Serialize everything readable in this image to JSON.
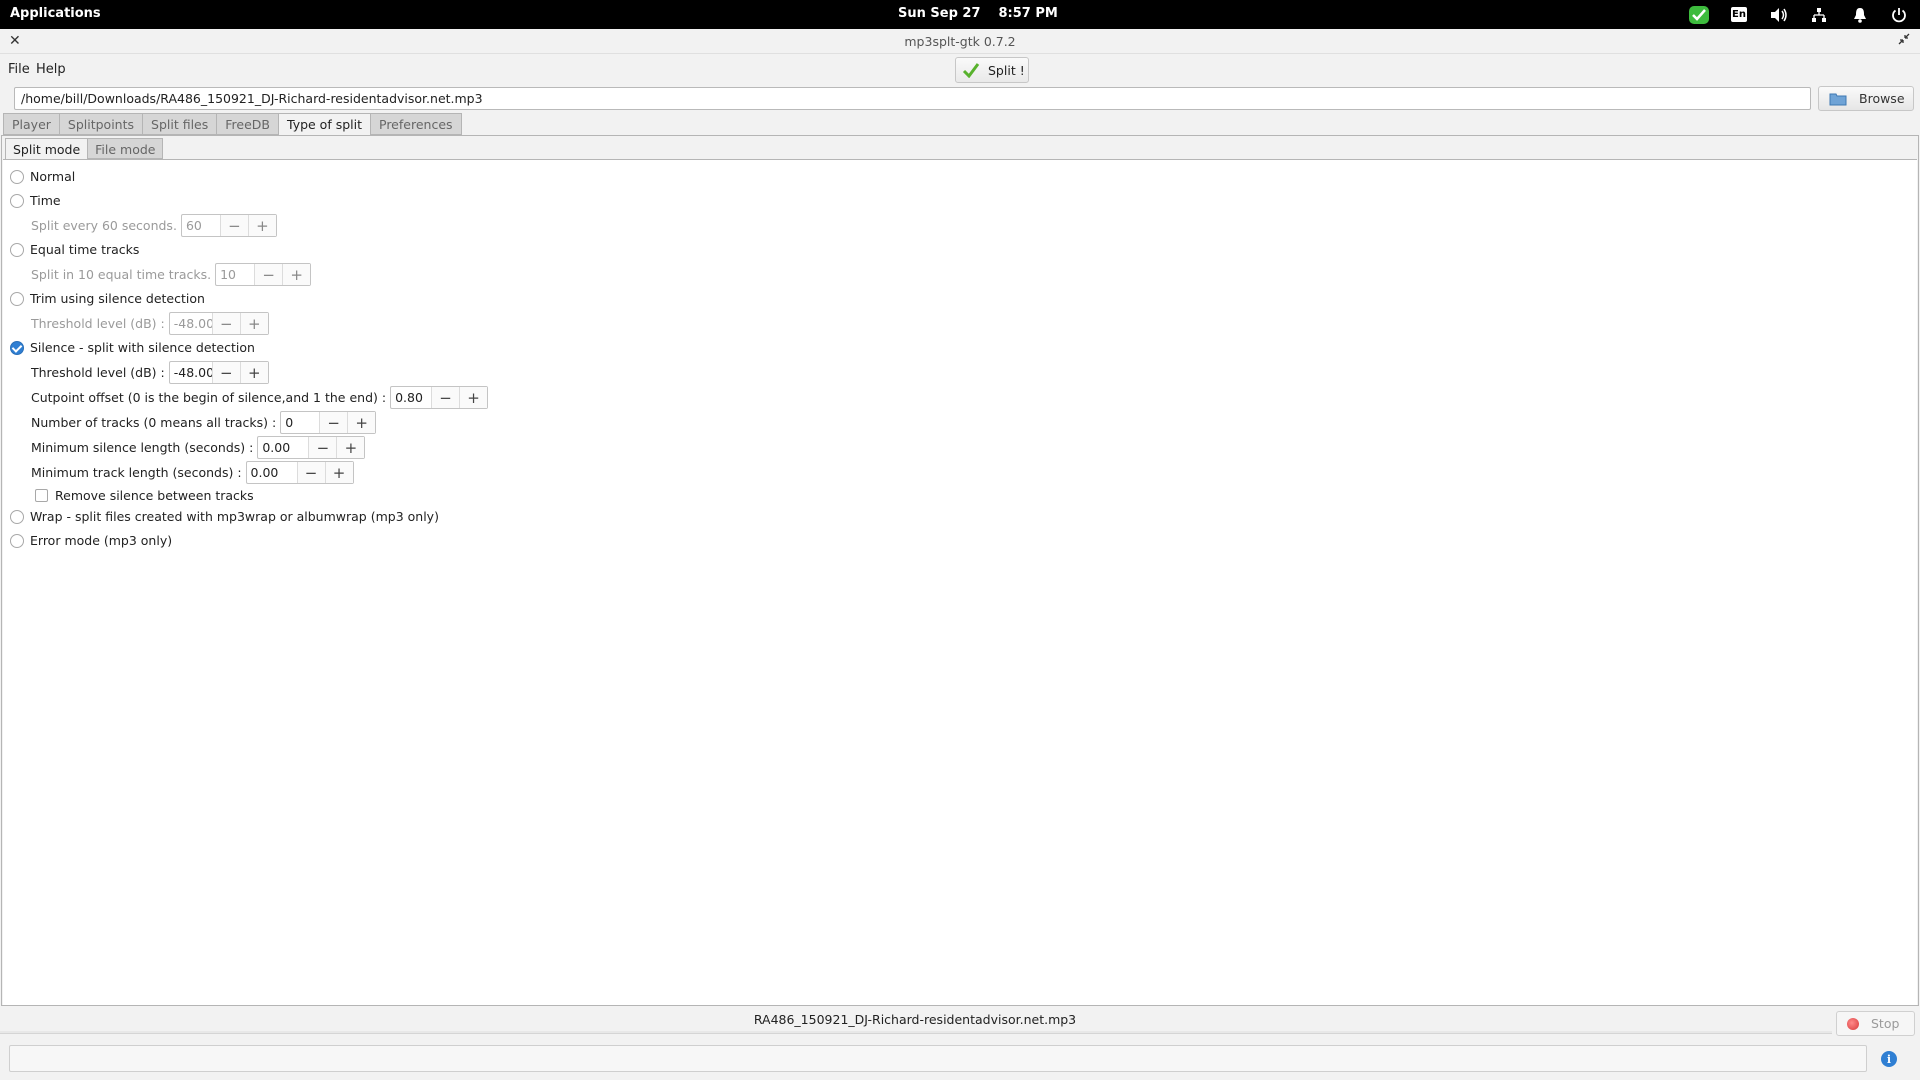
{
  "topbar": {
    "apps_label": "Applications",
    "date": "Sun Sep 27",
    "time": "8:57 PM",
    "lang": "En"
  },
  "window": {
    "title": "mp3splt-gtk 0.7.2"
  },
  "menu": {
    "file": "File",
    "help": "Help",
    "split_button": "Split !"
  },
  "path": {
    "value": "/home/bill/Downloads/RA486_150921_DJ-Richard-residentadvisor.net.mp3",
    "browse": "Browse"
  },
  "tabs": [
    "Player",
    "Splitpoints",
    "Split files",
    "FreeDB",
    "Type of split",
    "Preferences"
  ],
  "subtabs": [
    "Split mode",
    "File mode"
  ],
  "modes": {
    "normal": "Normal",
    "time": "Time",
    "time_sub": "Split every 60 seconds.",
    "time_value": "60",
    "equal": "Equal time tracks",
    "equal_sub": "Split in 10 equal time tracks.",
    "equal_value": "10",
    "trim": "Trim using silence detection",
    "trim_threshold_label": "Threshold level (dB) :",
    "trim_threshold_value": "-48.00",
    "silence": "Silence - split with silence detection",
    "silence_threshold_label": "Threshold level (dB) :",
    "silence_threshold_value": "-48.00",
    "cutpoint_label": "Cutpoint offset (0 is the begin of silence,and 1 the end) :",
    "cutpoint_value": "0.80",
    "tracks_label": "Number of tracks (0 means all tracks) :",
    "tracks_value": "0",
    "min_silence_label": "Minimum silence length (seconds) :",
    "min_silence_value": "0.00",
    "min_track_label": "Minimum track length (seconds) :",
    "min_track_value": "0.00",
    "remove_silence": "Remove silence between tracks",
    "wrap": "Wrap - split files created with mp3wrap or albumwrap (mp3 only)",
    "error": "Error mode (mp3 only)"
  },
  "status": {
    "filename": "RA486_150921_DJ-Richard-residentadvisor.net.mp3",
    "stop": "Stop"
  },
  "spin": {
    "minus": "−",
    "plus": "+"
  },
  "colors": {
    "accent": "#2f7fd3",
    "topbar": "#000000",
    "tray_check": "#3dbb3d"
  }
}
